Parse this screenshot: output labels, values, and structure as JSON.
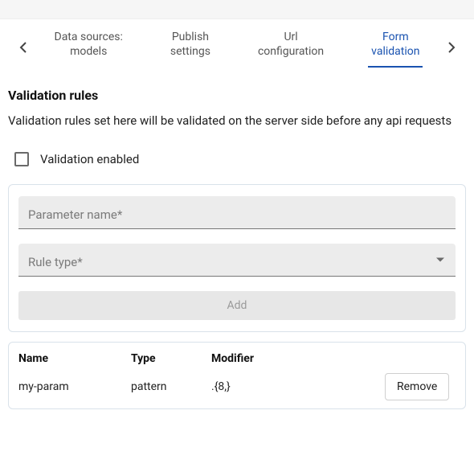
{
  "tabs": {
    "items": [
      {
        "line1": "Data sources:",
        "line2": "models"
      },
      {
        "line1": "Publish",
        "line2": "settings"
      },
      {
        "line1": "Url",
        "line2": "configuration"
      },
      {
        "line1": "Form",
        "line2": "validation"
      }
    ],
    "active_index": 3
  },
  "section": {
    "title": "Validation rules",
    "description": "Validation rules set here will be validated on the server side before any api requests"
  },
  "validation_enabled": {
    "label": "Validation enabled",
    "checked": false
  },
  "form": {
    "parameter_name_label": "Parameter name*",
    "rule_type_label": "Rule type*",
    "add_button_label": "Add"
  },
  "table": {
    "headers": {
      "name": "Name",
      "type": "Type",
      "modifier": "Modifier"
    },
    "rows": [
      {
        "name": "my-param",
        "type": "pattern",
        "modifier": ".{8,}"
      }
    ],
    "remove_label": "Remove"
  }
}
